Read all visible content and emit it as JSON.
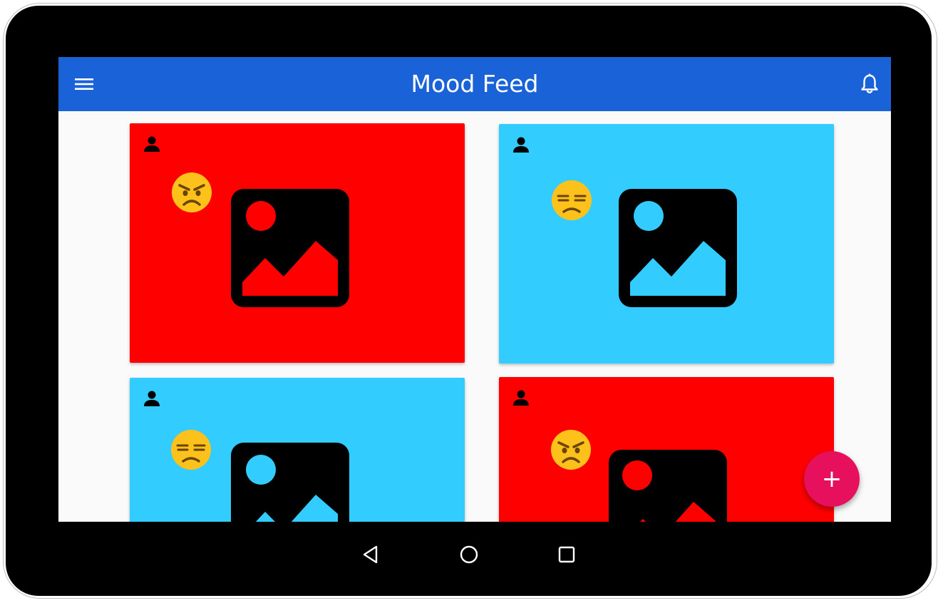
{
  "colors": {
    "appbar": "#1a62d8",
    "red_card": "#ff0000",
    "blue_card": "#33ccff",
    "fab": "#e7105d",
    "screen_bg": "#fafafa"
  },
  "appbar": {
    "title": "Mood Feed",
    "menu_icon": "menu-icon",
    "notification_icon": "bell-icon"
  },
  "feed": {
    "cards": [
      {
        "mood": "angry",
        "color": "red",
        "author_icon": "person-icon",
        "image_icon": "image-placeholder-icon"
      },
      {
        "mood": "annoyed",
        "color": "blue",
        "author_icon": "person-icon",
        "image_icon": "image-placeholder-icon"
      },
      {
        "mood": "annoyed",
        "color": "blue",
        "author_icon": "person-icon",
        "image_icon": "image-placeholder-icon"
      },
      {
        "mood": "angry",
        "color": "red",
        "author_icon": "person-icon",
        "image_icon": "image-placeholder-icon"
      }
    ]
  },
  "fab": {
    "label": "+",
    "icon": "add-icon"
  },
  "system_nav": {
    "back": "back-icon",
    "home": "home-icon",
    "recents": "recents-icon"
  }
}
